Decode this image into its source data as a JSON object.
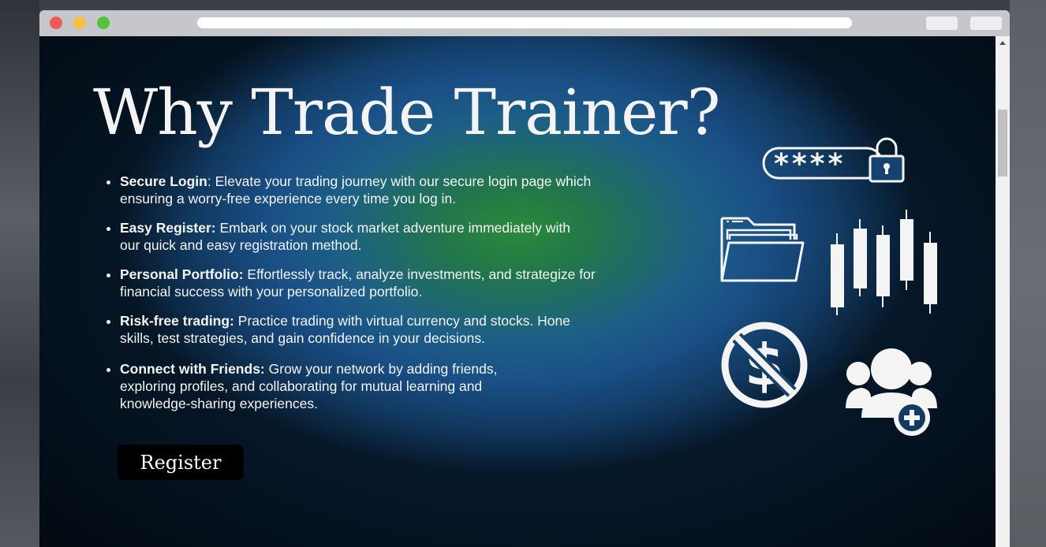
{
  "browser": {
    "window_controls": [
      "close",
      "minimize",
      "maximize"
    ],
    "url": ""
  },
  "hero": {
    "title": "Why Trade Trainer?",
    "features": [
      {
        "title": "Secure Login",
        "sep": ": ",
        "text": "Elevate your trading journey with our secure login page which ensuring a worry-free experience every time you log in."
      },
      {
        "title": "Easy Register:",
        "sep": " ",
        "text": "Embark on your stock market adventure immediately with our quick and easy registration method."
      },
      {
        "title": "Personal Portfolio:",
        "sep": " ",
        "text": "Effortlessly track, analyze investments, and strategize for financial success with your personalized portfolio."
      },
      {
        "title": "Risk-free trading:",
        "sep": " ",
        "text": "Practice trading with virtual currency and stocks. Hone skills, test strategies, and gain confidence in your decisions."
      },
      {
        "title": "Connect with Friends:",
        "sep": " ",
        "text": "Grow your network by adding friends, exploring profiles, and collaborating for mutual learning and knowledge-sharing experiences."
      }
    ],
    "register_label": "Register",
    "password_mask": "****"
  },
  "icons": [
    "password-lock-icon",
    "folder-icon",
    "candlestick-chart-icon",
    "no-money-icon",
    "add-friends-icon"
  ],
  "colors": {
    "text": "#f4f4f4",
    "button_bg": "#000000",
    "bg_center": "#2a8a3a",
    "bg_mid": "#1d5f86",
    "bg_edge": "#061728"
  }
}
